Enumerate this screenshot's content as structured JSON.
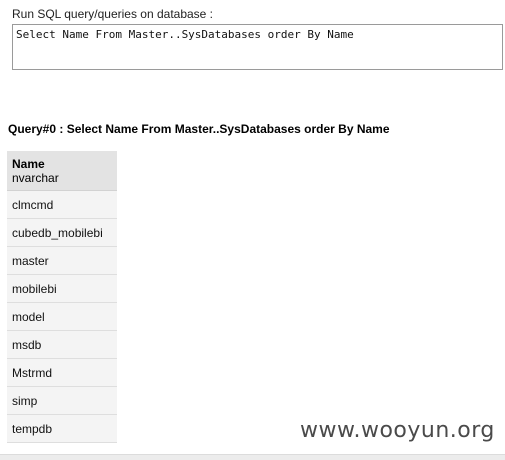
{
  "query_form": {
    "label": "Run SQL query/queries on database :",
    "query_text": "Select Name From Master..SysDatabases order By Name"
  },
  "result": {
    "heading": "Query#0 : Select Name From Master..SysDatabases order By Name",
    "column": {
      "name": "Name",
      "type": "nvarchar"
    },
    "rows": [
      "clmcmd",
      "cubedb_mobilebi",
      "master",
      "mobilebi",
      "model",
      "msdb",
      "Mstrmd",
      "simp",
      "tempdb"
    ]
  },
  "watermark": "www.wooyun.org"
}
